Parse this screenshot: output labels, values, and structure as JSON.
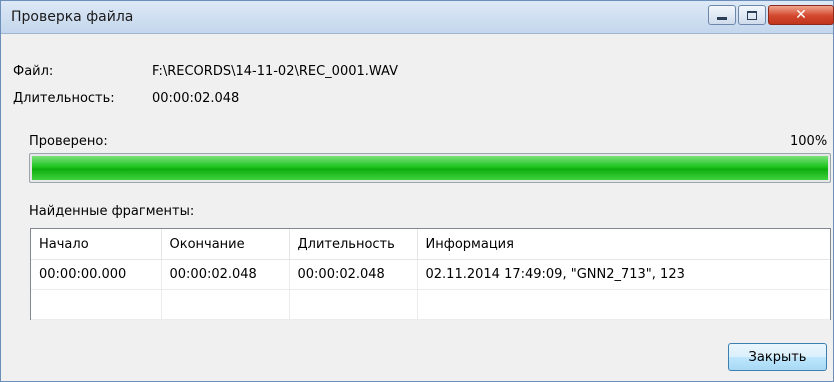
{
  "window": {
    "title": "Проверка файла"
  },
  "file": {
    "label": "Файл:",
    "path": "F:\\RECORDS\\14-11-02\\REC_0001.WAV",
    "duration_label": "Длительность:",
    "duration": "00:00:02.048"
  },
  "progress": {
    "label": "Проверено:",
    "percent_text": "100%",
    "value": 1.0
  },
  "fragments": {
    "label": "Найденные фрагменты:",
    "columns": [
      "Начало",
      "Окончание",
      "Длительность",
      "Информация"
    ],
    "rows": [
      [
        "00:00:00.000",
        "00:00:02.048",
        "00:00:02.048",
        "02.11.2014 17:49:09, \"GNN2_713\", 123"
      ]
    ]
  },
  "buttons": {
    "close_label": "Закрыть"
  },
  "colors": {
    "progress": "#1ec41e",
    "titlebar": "#c3d6ec",
    "close_button": "#d2472c"
  }
}
